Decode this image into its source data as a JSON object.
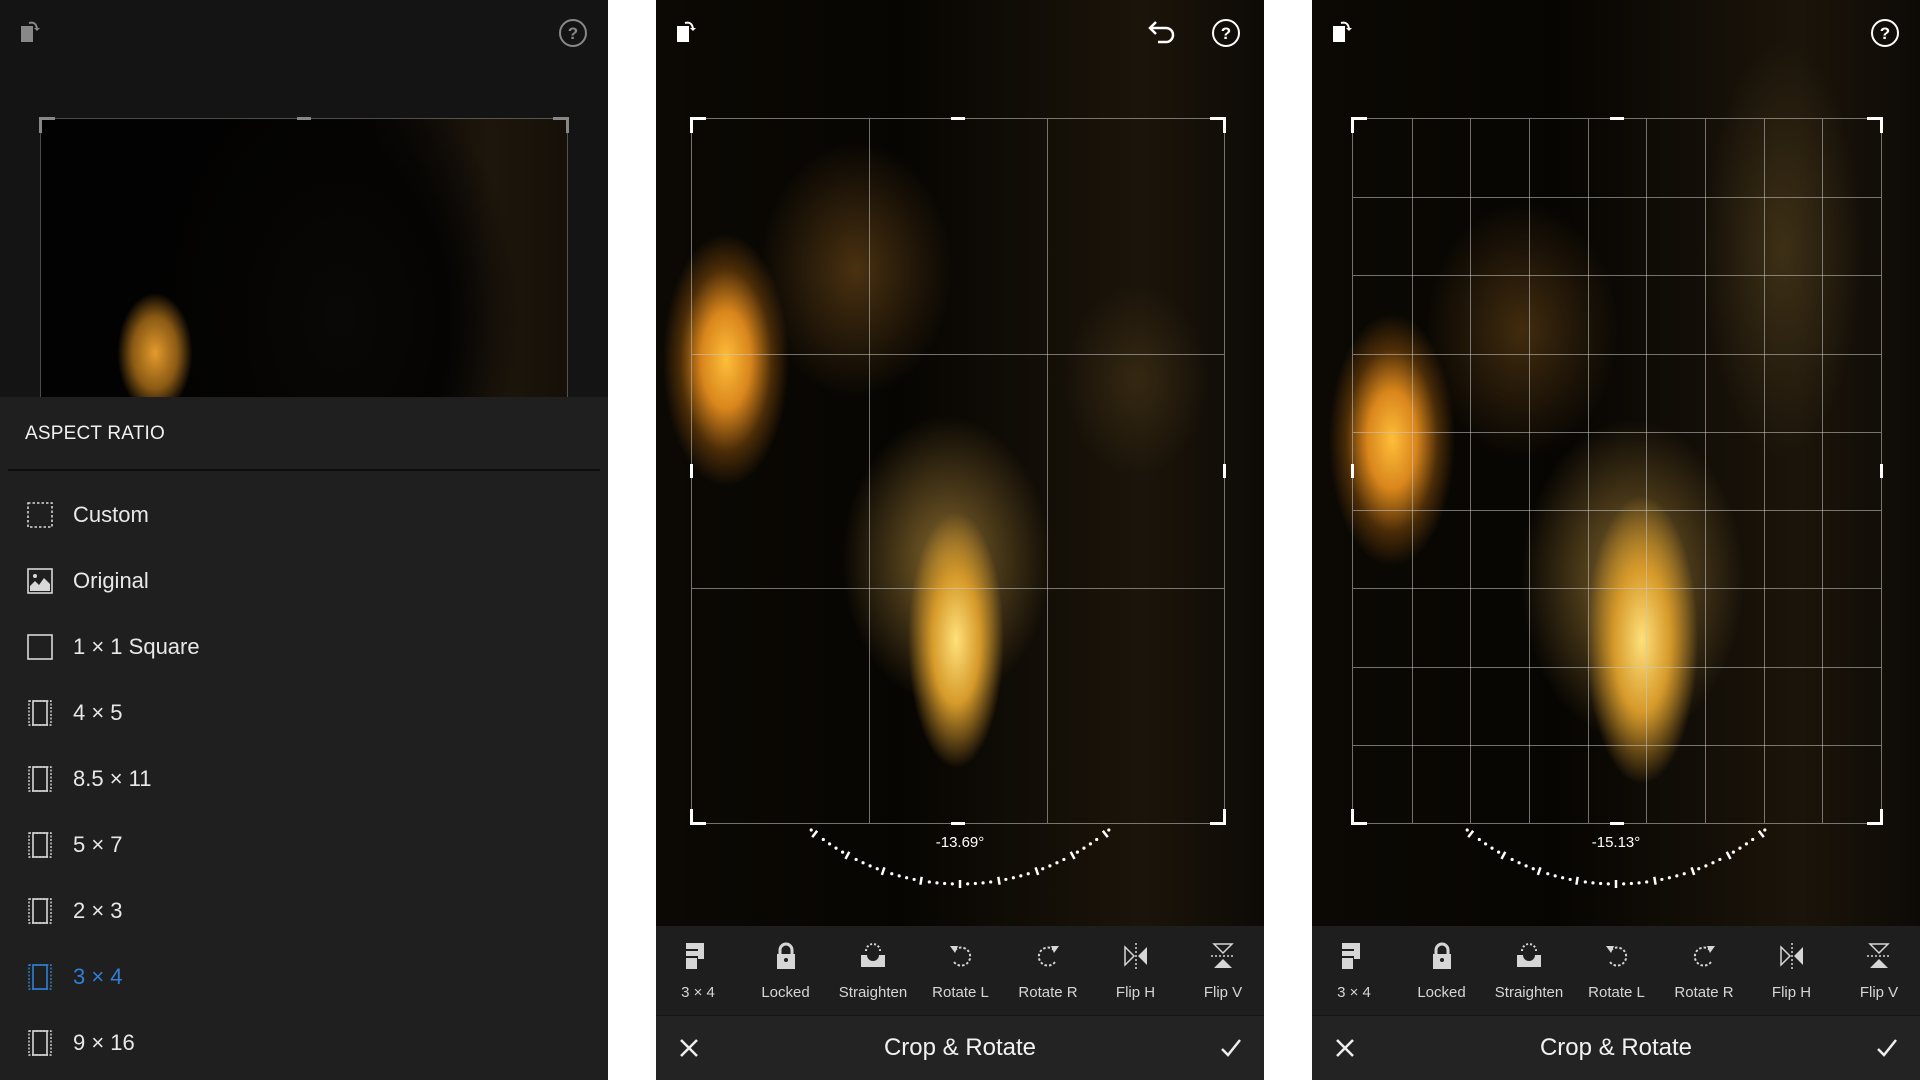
{
  "colors": {
    "accent": "#2f7fd6",
    "panel_bg": "#141414",
    "sheet_bg": "#1f1f1f"
  },
  "panel1": {
    "top_icons": {
      "left": "rotate-canvas-icon",
      "right": "help-icon"
    },
    "aspect_ratio": {
      "title": "ASPECT RATIO",
      "selected": "3 × 4",
      "items": [
        {
          "label": "Custom",
          "icon": "custom-dashed-square-icon"
        },
        {
          "label": "Original",
          "icon": "original-image-icon"
        },
        {
          "label": "1 × 1  Square",
          "icon": "square-icon"
        },
        {
          "label": "4 × 5",
          "icon": "portrait-frame-icon"
        },
        {
          "label": "8.5 × 11",
          "icon": "portrait-frame-icon"
        },
        {
          "label": "5 × 7",
          "icon": "portrait-frame-icon"
        },
        {
          "label": "2 × 3",
          "icon": "portrait-frame-icon"
        },
        {
          "label": "3 × 4",
          "icon": "portrait-frame-icon"
        },
        {
          "label": "9 × 16",
          "icon": "portrait-frame-icon"
        }
      ]
    }
  },
  "panel2": {
    "top_icons": {
      "left": "rotate-canvas-icon",
      "undo": "undo-icon",
      "right": "help-icon"
    },
    "angle": "-13.69°",
    "grid": "3x3"
  },
  "panel3": {
    "top_icons": {
      "left": "rotate-canvas-icon",
      "right": "help-icon"
    },
    "angle": "-15.13°",
    "grid": "9x9"
  },
  "toolbar": {
    "tools": [
      {
        "label": "3 × 4",
        "icon": "aspect-ratio-icon"
      },
      {
        "label": "Locked",
        "icon": "lock-icon"
      },
      {
        "label": "Straighten",
        "icon": "straighten-icon"
      },
      {
        "label": "Rotate L",
        "icon": "rotate-left-icon"
      },
      {
        "label": "Rotate R",
        "icon": "rotate-right-icon"
      },
      {
        "label": "Flip H",
        "icon": "flip-horizontal-icon"
      },
      {
        "label": "Flip V",
        "icon": "flip-vertical-icon"
      }
    ]
  },
  "titlebar": {
    "title": "Crop & Rotate",
    "cancel": "close-icon",
    "confirm": "check-icon"
  }
}
